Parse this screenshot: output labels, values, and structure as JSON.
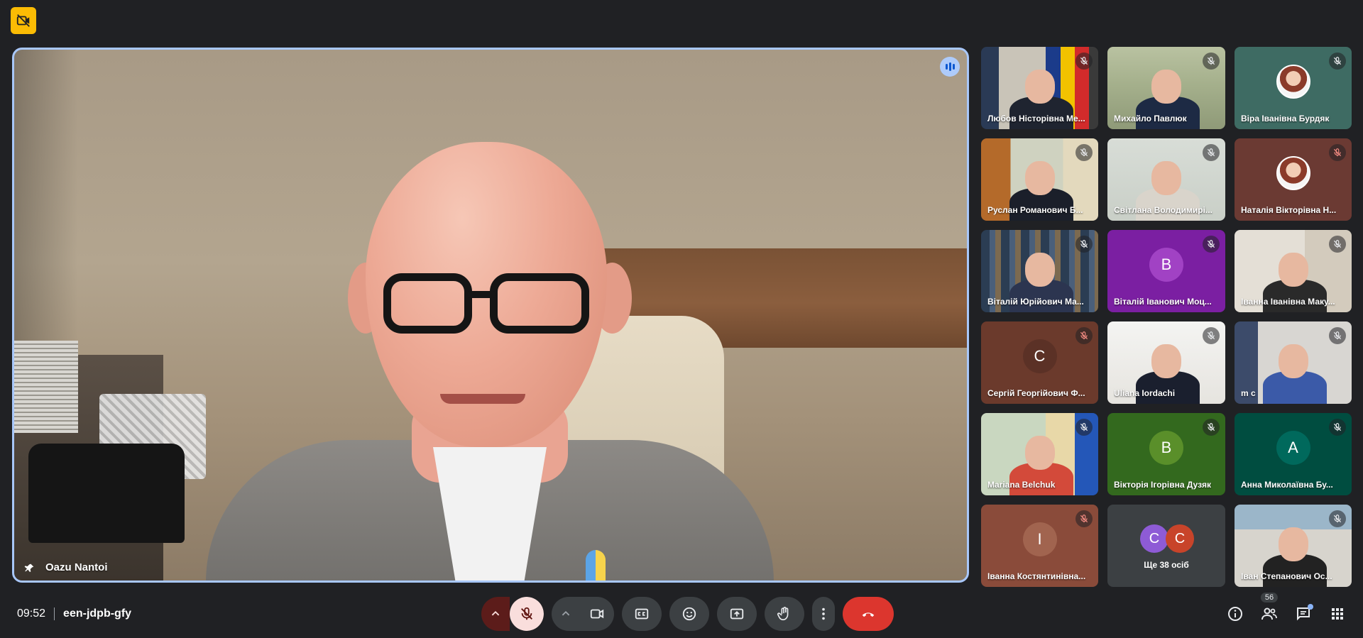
{
  "colors": {
    "background": "#202124",
    "speaker_border": "#a8c7fa",
    "end_call": "#dc362e",
    "badge": "#fbbc04"
  },
  "speaker": {
    "name": "Oazu Nantoi"
  },
  "participants": [
    {
      "name": "Любов Ністорівна Ме...",
      "muted": true,
      "style": "video-flags"
    },
    {
      "name": "Михайло Павлюк",
      "muted": true,
      "style": "video-map"
    },
    {
      "name": "Віра Іванівна Бурдяк",
      "muted": true,
      "style": "photo",
      "bg": "#3e6b63"
    },
    {
      "name": "Руслан Романович Б...",
      "muted": true,
      "style": "video-office"
    },
    {
      "name": "Світлана Володимирі...",
      "muted": true,
      "style": "video-wall"
    },
    {
      "name": "Наталія Вікторівна Н...",
      "muted": true,
      "style": "photo",
      "bg": "#6b3a33",
      "muted_red": true
    },
    {
      "name": "Віталій Юрійович Ма...",
      "muted": true,
      "style": "video-books"
    },
    {
      "name": "Віталій Іванович Моц...",
      "muted": true,
      "style": "letter",
      "letter": "В",
      "bg": "#7b1fa2",
      "av": "#a142c4"
    },
    {
      "name": "Іванна Іванівна Маку...",
      "muted": true,
      "style": "video-shelf"
    },
    {
      "name": "Сергій Георгійович Ф...",
      "muted": true,
      "style": "letter",
      "letter": "С",
      "bg": "#6b3a2c",
      "av": "#5b3126",
      "muted_red": true
    },
    {
      "name": "Uliana Iordachi",
      "muted": true,
      "style": "video-bright"
    },
    {
      "name": "m c",
      "muted": true,
      "style": "video-room"
    },
    {
      "name": "Mariana Belchuk",
      "muted": true,
      "style": "video-mapflag"
    },
    {
      "name": "Вікторія Ігорівна Дузяк",
      "muted": true,
      "style": "letter",
      "letter": "В",
      "bg": "#33691e",
      "av": "#5a8f2a"
    },
    {
      "name": "Анна Миколаївна Бу...",
      "muted": true,
      "style": "letter",
      "letter": "А",
      "bg": "#004d40",
      "av": "#00695c"
    },
    {
      "name": "Іванна Костянтинівна...",
      "muted": true,
      "style": "letter",
      "letter": "І",
      "bg": "#8a4b3a",
      "av": "#a1644f",
      "muted_red": true
    },
    {
      "style": "others"
    },
    {
      "name": "Іван Степанович Ос...",
      "muted": true,
      "style": "video-duo"
    }
  ],
  "others": {
    "label": "Ще 38 осіб",
    "avatars": [
      {
        "letter": "С",
        "color": "#8e5bd6"
      },
      {
        "letter": "С",
        "color": "#c8442a"
      }
    ]
  },
  "bottom": {
    "time": "09:52",
    "meeting_code": "een-jdpb-gfy",
    "participant_count": "56"
  },
  "icons": [
    "camera-off-badge-icon",
    "push-pin-icon",
    "voice-activity-icon",
    "mic-off-icon",
    "chevron-up-icon",
    "videocam-icon",
    "captions-icon",
    "emoji-icon",
    "present-icon",
    "raise-hand-icon",
    "more-vert-icon",
    "call-end-icon",
    "info-icon",
    "people-icon",
    "chat-icon",
    "apps-icon"
  ]
}
